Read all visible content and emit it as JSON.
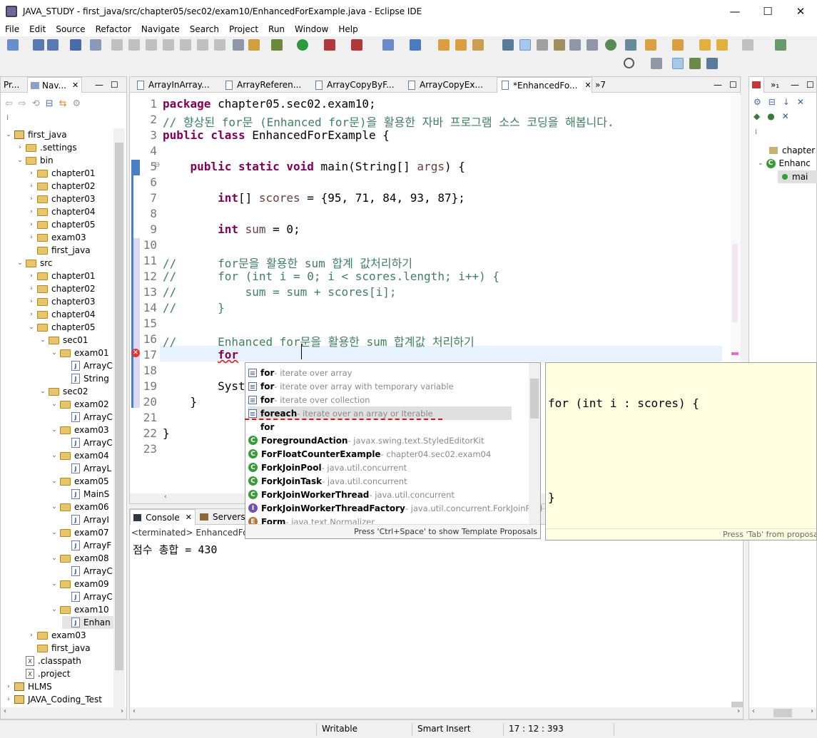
{
  "window": {
    "title": "JAVA_STUDY - first_java/src/chapter05/sec02/exam10/EnhancedForExample.java - Eclipse IDE",
    "minimize": "—",
    "maximize": "☐",
    "close": "✕"
  },
  "menu": [
    "File",
    "Edit",
    "Source",
    "Refactor",
    "Navigate",
    "Search",
    "Project",
    "Run",
    "Window",
    "Help"
  ],
  "left_tabs": [
    {
      "label": "Pr..."
    },
    {
      "label": "Nav..."
    }
  ],
  "tree": [
    {
      "label": "first_java",
      "depth": 0,
      "icon": "project",
      "open": true
    },
    {
      "label": ".settings",
      "depth": 1,
      "icon": "folder",
      "open": false
    },
    {
      "label": "bin",
      "depth": 1,
      "icon": "folder",
      "open": true
    },
    {
      "label": "chapter01",
      "depth": 2,
      "icon": "folder",
      "open": false
    },
    {
      "label": "chapter02",
      "depth": 2,
      "icon": "folder",
      "open": false
    },
    {
      "label": "chapter03",
      "depth": 2,
      "icon": "folder",
      "open": false
    },
    {
      "label": "chapter04",
      "depth": 2,
      "icon": "folder",
      "open": false
    },
    {
      "label": "chapter05",
      "depth": 2,
      "icon": "folder",
      "open": false
    },
    {
      "label": "exam03",
      "depth": 2,
      "icon": "folder",
      "open": false
    },
    {
      "label": "first_java",
      "depth": 2,
      "icon": "folder",
      "open": null
    },
    {
      "label": "src",
      "depth": 1,
      "icon": "folder",
      "open": true
    },
    {
      "label": "chapter01",
      "depth": 2,
      "icon": "folder",
      "open": false
    },
    {
      "label": "chapter02",
      "depth": 2,
      "icon": "folder",
      "open": false
    },
    {
      "label": "chapter03",
      "depth": 2,
      "icon": "folder",
      "open": false
    },
    {
      "label": "chapter04",
      "depth": 2,
      "icon": "folder",
      "open": false
    },
    {
      "label": "chapter05",
      "depth": 2,
      "icon": "folder",
      "open": true
    },
    {
      "label": "sec01",
      "depth": 3,
      "icon": "folder",
      "open": true
    },
    {
      "label": "exam01",
      "depth": 4,
      "icon": "folder",
      "open": true
    },
    {
      "label": "ArrayC",
      "depth": 5,
      "icon": "java",
      "open": null
    },
    {
      "label": "String",
      "depth": 5,
      "icon": "java",
      "open": null
    },
    {
      "label": "sec02",
      "depth": 3,
      "icon": "folder",
      "open": true
    },
    {
      "label": "exam02",
      "depth": 4,
      "icon": "folder",
      "open": true
    },
    {
      "label": "ArrayC",
      "depth": 5,
      "icon": "java",
      "open": null
    },
    {
      "label": "exam03",
      "depth": 4,
      "icon": "folder",
      "open": true
    },
    {
      "label": "ArrayC",
      "depth": 5,
      "icon": "java",
      "open": null
    },
    {
      "label": "exam04",
      "depth": 4,
      "icon": "folder",
      "open": true
    },
    {
      "label": "ArrayL",
      "depth": 5,
      "icon": "java",
      "open": null
    },
    {
      "label": "exam05",
      "depth": 4,
      "icon": "folder",
      "open": true
    },
    {
      "label": "MainS",
      "depth": 5,
      "icon": "java",
      "open": null
    },
    {
      "label": "exam06",
      "depth": 4,
      "icon": "folder",
      "open": true
    },
    {
      "label": "ArrayI",
      "depth": 5,
      "icon": "java",
      "open": null
    },
    {
      "label": "exam07",
      "depth": 4,
      "icon": "folder",
      "open": true
    },
    {
      "label": "ArrayF",
      "depth": 5,
      "icon": "java",
      "open": null
    },
    {
      "label": "exam08",
      "depth": 4,
      "icon": "folder",
      "open": true
    },
    {
      "label": "ArrayC",
      "depth": 5,
      "icon": "java",
      "open": null
    },
    {
      "label": "exam09",
      "depth": 4,
      "icon": "folder",
      "open": true
    },
    {
      "label": "ArrayC",
      "depth": 5,
      "icon": "java",
      "open": null
    },
    {
      "label": "exam10",
      "depth": 4,
      "icon": "folder",
      "open": true
    },
    {
      "label": "Enhan",
      "depth": 5,
      "icon": "java",
      "open": null,
      "selected": true
    },
    {
      "label": "exam03",
      "depth": 2,
      "icon": "folder",
      "open": false
    },
    {
      "label": "first_java",
      "depth": 2,
      "icon": "folder",
      "open": null
    },
    {
      "label": ".classpath",
      "depth": 1,
      "icon": "xml",
      "open": null
    },
    {
      "label": ".project",
      "depth": 1,
      "icon": "xml",
      "open": null
    },
    {
      "label": "HLMS",
      "depth": 0,
      "icon": "project",
      "open": false
    },
    {
      "label": "JAVA_Coding_Test",
      "depth": 0,
      "icon": "project",
      "open": false
    }
  ],
  "editor_tabs": [
    {
      "label": "ArrayInArray..."
    },
    {
      "label": "ArrayReferen..."
    },
    {
      "label": "ArrayCopyByF..."
    },
    {
      "label": "ArrayCopyEx..."
    },
    {
      "label": "*EnhancedFo...",
      "active": true
    }
  ],
  "editor_tab_overflow": "»7",
  "code_lines": [
    {
      "n": "1",
      "html": "<span class=\"kw\">package</span> chapter05.sec02.exam10;"
    },
    {
      "n": "2",
      "html": "<span class=\"cm\">// 향상된 for문 (Enhanced for문)을 활용한 자바 프로그램 소스 코딩을 해봅니다.</span>"
    },
    {
      "n": "3",
      "html": "<span class=\"kw\">public class</span> EnhancedForExample {"
    },
    {
      "n": "4",
      "html": ""
    },
    {
      "n": "5",
      "html": "    <span class=\"kw\">public static void</span> main(String[] <span class=\"var\">args</span>) {"
    },
    {
      "n": "6",
      "html": ""
    },
    {
      "n": "7",
      "html": "        <span class=\"kw\">int</span>[] <span class=\"var\">scores</span> = {95, 71, 84, 93, 87};"
    },
    {
      "n": "8",
      "html": ""
    },
    {
      "n": "9",
      "html": "        <span class=\"kw\">int</span> <span class=\"var\">sum</span> = 0;"
    },
    {
      "n": "10",
      "html": ""
    },
    {
      "n": "11",
      "html": "<span class=\"cm\">//      for문을 활용한 sum 합계 값처리하기</span>"
    },
    {
      "n": "12",
      "html": "<span class=\"cm\">//      for (int i = 0; i &lt; scores.length; i++) {</span>"
    },
    {
      "n": "13",
      "html": "<span class=\"cm\">//          sum = sum + scores[i];</span>"
    },
    {
      "n": "14",
      "html": "<span class=\"cm\">//      }</span>"
    },
    {
      "n": "15",
      "html": ""
    },
    {
      "n": "16",
      "html": "<span class=\"cm\">//      Enhanced for문을 활용한 sum 합계값 처리하기</span>"
    },
    {
      "n": "17",
      "html": "        <span style=\"color:#7f0055;font-weight:bold;text-decoration:underline wavy #e02020\">for</span>"
    },
    {
      "n": "18",
      "html": ""
    },
    {
      "n": "19",
      "html": "        Syst"
    },
    {
      "n": "20",
      "html": "    }"
    },
    {
      "n": "21",
      "html": ""
    },
    {
      "n": "22",
      "html": "}"
    },
    {
      "n": "23",
      "html": ""
    }
  ],
  "assist": {
    "items": [
      {
        "icon": "template",
        "name": "for",
        "desc": " - iterate over array"
      },
      {
        "icon": "template",
        "name": "for",
        "desc": " - iterate over array with temporary variable"
      },
      {
        "icon": "template",
        "name": "for",
        "desc": " - iterate over collection"
      },
      {
        "icon": "template",
        "name": "foreach",
        "desc": " - iterate over an array or Iterable",
        "selected": true
      },
      {
        "icon": "none",
        "name": "for",
        "desc": ""
      },
      {
        "icon": "class",
        "name": "ForegroundAction",
        "desc": " - javax.swing.text.StyledEditorKit"
      },
      {
        "icon": "class",
        "name": "ForFloatCounterExample",
        "desc": " - chapter04.sec02.exam04"
      },
      {
        "icon": "class",
        "name": "ForkJoinPool",
        "desc": " - java.util.concurrent"
      },
      {
        "icon": "class",
        "name": "ForkJoinTask",
        "desc": " - java.util.concurrent"
      },
      {
        "icon": "class",
        "name": "ForkJoinWorkerThread",
        "desc": " - java.util.concurrent"
      },
      {
        "icon": "interface",
        "name": "ForkJoinWorkerThreadFactory",
        "desc": " - java.util.concurrent.ForkJoinPool"
      },
      {
        "icon": "enum",
        "name": "Form",
        "desc": " - java.text.Normalizer"
      }
    ],
    "footer": "Press 'Ctrl+Space' to show Template Proposals",
    "preview_lines": [
      "for (int i : scores) {",
      "",
      "}"
    ],
    "preview_footer": "Press 'Tab' from proposal"
  },
  "console": {
    "tabs": [
      {
        "label": "Console"
      },
      {
        "label": "Servers"
      }
    ],
    "header": "<terminated> EnhancedForExample [Java Application]",
    "output": "점수 총합 = 430"
  },
  "outline": {
    "items": [
      {
        "label": "chapter"
      },
      {
        "label": "Enhanc"
      },
      {
        "label": "mai"
      }
    ]
  },
  "status": {
    "writable": "Writable",
    "insert_mode": "Smart Insert",
    "position": "17 : 12 : 393"
  },
  "colors": {
    "keyword": "#7f0055",
    "comment": "#3f7f5f",
    "variable": "#6a3e3e",
    "line_number": "#787878",
    "preview_bg": "#ffffe1",
    "selection": "#e0e0e0",
    "error_squiggle": "#e02020"
  }
}
